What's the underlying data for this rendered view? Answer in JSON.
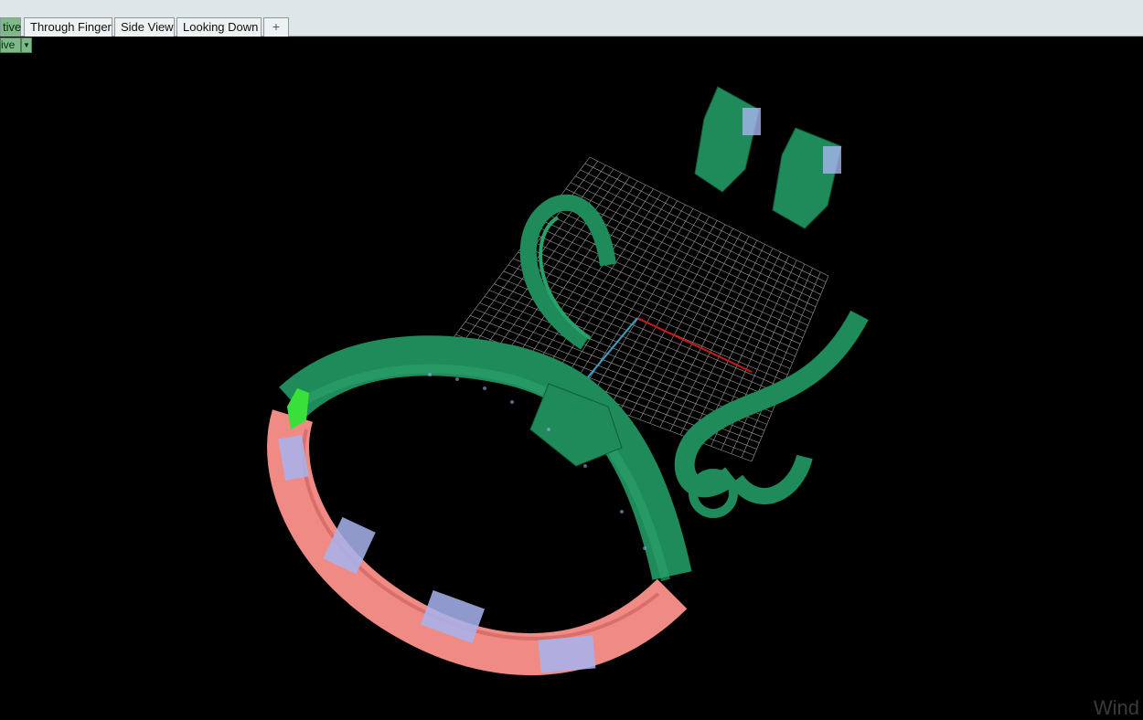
{
  "tabs": [
    {
      "label": "tive",
      "active": true
    },
    {
      "label": "Through Finger",
      "active": false
    },
    {
      "label": "Side View",
      "active": false
    },
    {
      "label": "Looking Down",
      "active": false
    }
  ],
  "add_tab_icon": "plus-icon",
  "viewport": {
    "label": "ive",
    "dropdown_icon": "triangle-down-icon"
  },
  "colors": {
    "background": "#000000",
    "grid": "#9a9a9a",
    "model_green": "#1f8a5a",
    "model_pink": "#f08a84",
    "gem_lavender": "#a8b4f0",
    "highlight_green": "#39e03a",
    "axis_x": "#d01818",
    "axis_y": "#3aa0c0"
  },
  "watermark": "Wind"
}
